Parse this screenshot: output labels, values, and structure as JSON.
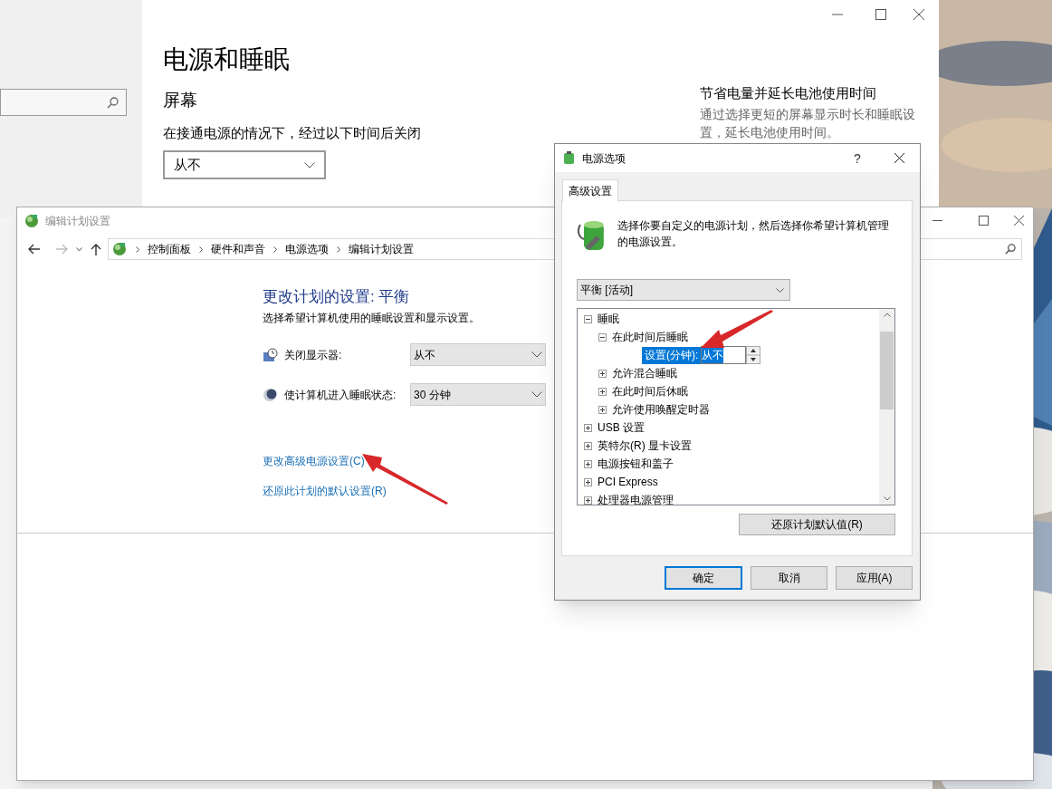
{
  "settings_window": {
    "title": "电源和睡眠",
    "section": "屏幕",
    "screen_label": "在接通电源的情况下，经过以下时间后关闭",
    "screen_dropdown": "从不",
    "side_title": "节省电量并延长电池使用时间",
    "side_text": "通过选择更短的屏幕显示时长和睡眠设置，延长电池使用时间。"
  },
  "edit_window": {
    "title": "编辑计划设置",
    "breadcrumb": [
      "控制面板",
      "硬件和声音",
      "电源选项",
      "编辑计划设置"
    ],
    "heading": "更改计划的设置: 平衡",
    "subtitle": "选择希望计算机使用的睡眠设置和显示设置。",
    "settings": [
      {
        "kind": "display",
        "label": "关闭显示器:",
        "value": "从不"
      },
      {
        "kind": "sleep",
        "label": "使计算机进入睡眠状态:",
        "value": "30 分钟"
      }
    ],
    "links": [
      "更改高级电源设置(C)",
      "还原此计划的默认设置(R)"
    ]
  },
  "dialog": {
    "title": "电源选项",
    "help": "?",
    "tabs": [
      {
        "label": "高级设置",
        "selected": true
      }
    ],
    "intro": "选择你要自定义的电源计划，然后选择你希望计算机管理的电源设置。",
    "plan": "平衡 [活动]",
    "tree": [
      {
        "label": "睡眠",
        "expanded": true,
        "children": [
          {
            "label": "在此时间后睡眠",
            "expanded": true,
            "children": [
              {
                "kind": "setting",
                "label": "设置(分钟):",
                "value": "从不",
                "selected": true
              }
            ]
          },
          {
            "label": "允许混合睡眠",
            "expanded": false
          },
          {
            "label": "在此时间后休眠",
            "expanded": false
          },
          {
            "label": "允许使用唤醒定时器",
            "expanded": false
          }
        ]
      },
      {
        "label": "USB 设置",
        "expanded": false
      },
      {
        "label": "英特尔(R) 显卡设置",
        "expanded": false
      },
      {
        "label": "电源按钮和盖子",
        "expanded": false
      },
      {
        "label": "PCI Express",
        "expanded": false
      },
      {
        "label": "处理器电源管理",
        "expanded": false
      }
    ],
    "restore_button": "还原计划默认值(R)",
    "buttons": [
      {
        "label": "确定",
        "default": true
      },
      {
        "label": "取消",
        "default": false
      },
      {
        "label": "应用(A)",
        "default": false
      }
    ]
  }
}
